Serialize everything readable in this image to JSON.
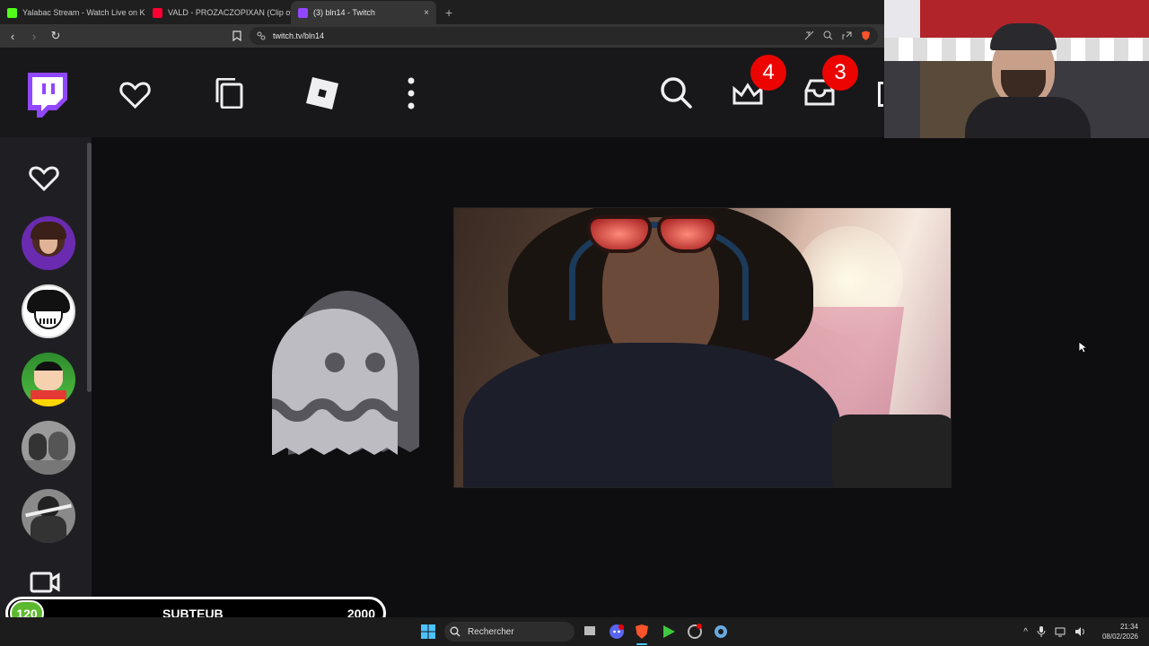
{
  "browser": {
    "tabs": [
      {
        "title": "Yalabac Stream - Watch Live on Kick",
        "favicon_color": "#53fc18",
        "active": false
      },
      {
        "title": "VALD - PROZACZOPIXAN (Clip offici",
        "favicon_color": "#ff0033",
        "active": false
      },
      {
        "title": "(3) bln14 - Twitch",
        "favicon_color": "#9146ff",
        "active": true
      }
    ],
    "new_tab": "+",
    "close_glyph": "×",
    "back": "‹",
    "forward": "›",
    "reload": "↻",
    "url": "twitch.tv/bln14"
  },
  "twitch_nav": {
    "accent": "#9146ff",
    "icons": [
      "twitch-logo-icon",
      "heart-icon",
      "browse-icon",
      "roblox-icon",
      "more-icon",
      "search-icon",
      "prime-crown-icon",
      "inbox-icon"
    ],
    "prime_badge": "4",
    "inbox_badge": "3"
  },
  "sidebar": {
    "followed_icon": "heart-icon",
    "channels": [
      "avatar-1",
      "avatar-2",
      "avatar-3",
      "avatar-4",
      "avatar-5"
    ],
    "camera_icon": "camera-icon"
  },
  "subgoal": {
    "count": "120",
    "label": "SUBTEUB",
    "goal": "2000",
    "color": "#5cb82e"
  },
  "taskbar": {
    "search_label": "Rechercher",
    "time": "21:34",
    "date": "08/02/2026",
    "tray_arrow": "^"
  }
}
